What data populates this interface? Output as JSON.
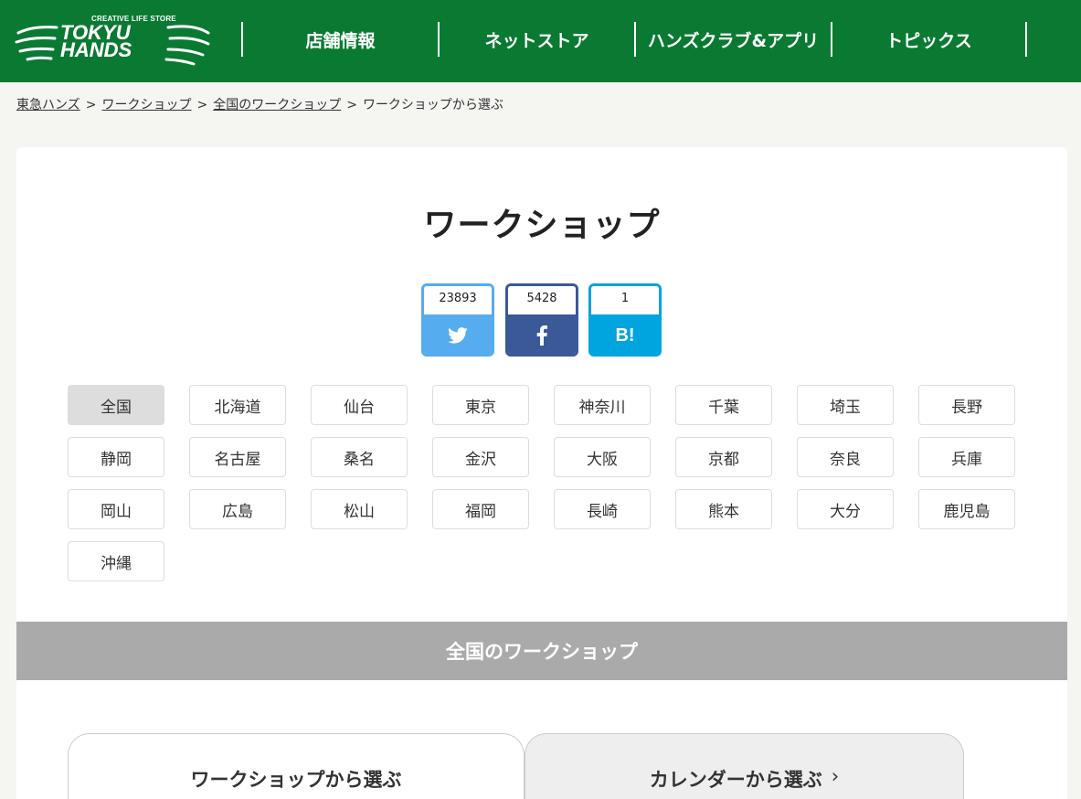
{
  "header": {
    "logo_tagline": "CREATIVE LIFE STORE",
    "logo_text": "TOKYU HANDS",
    "nav": [
      "店舗情報",
      "ネットストア",
      "ハンズクラブ&アプリ",
      "トピックス"
    ]
  },
  "breadcrumb": {
    "items": [
      "東急ハンズ",
      "ワークショップ",
      "全国のワークショップ"
    ],
    "current": "ワークショップから選ぶ",
    "separator": ">"
  },
  "title": "ワークショップ",
  "share": {
    "twitter": "23893",
    "facebook": "5428",
    "hatena": "1",
    "hatena_label": "B!"
  },
  "regions": [
    "全国",
    "北海道",
    "仙台",
    "東京",
    "神奈川",
    "千葉",
    "埼玉",
    "長野",
    "静岡",
    "名古屋",
    "桑名",
    "金沢",
    "大阪",
    "京都",
    "奈良",
    "兵庫",
    "岡山",
    "広島",
    "松山",
    "福岡",
    "長崎",
    "熊本",
    "大分",
    "鹿児島",
    "沖縄"
  ],
  "section_title": "全国のワークショップ",
  "tabs": {
    "workshop": "ワークショップから選ぶ",
    "calendar": "カレンダーから選ぶ",
    "chevron": "›"
  },
  "colors": {
    "brand_green": "#0a7a32",
    "twitter": "#55acee",
    "facebook": "#3b5998",
    "hatena": "#00a4de"
  }
}
